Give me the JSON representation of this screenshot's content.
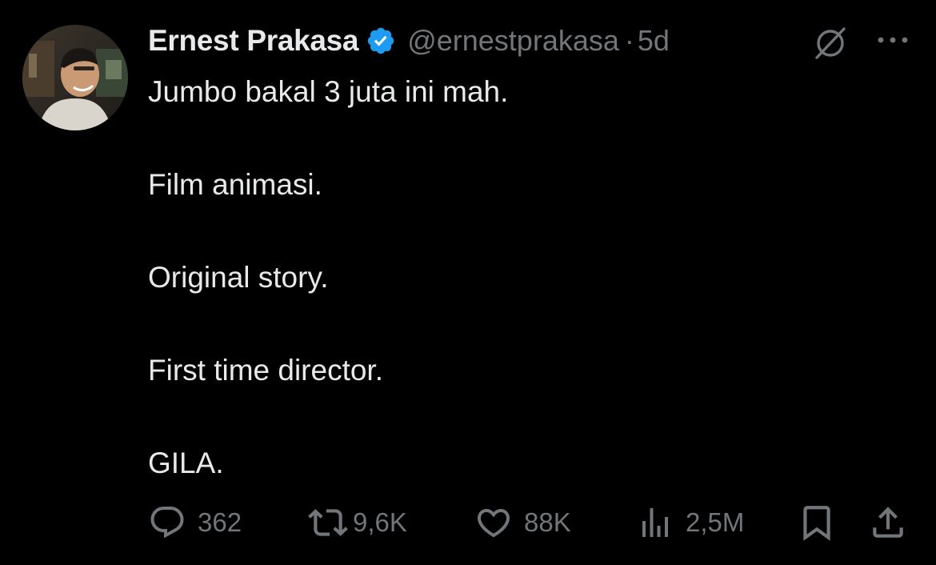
{
  "author": {
    "display_name": "Ernest Prakasa",
    "handle": "@ernestprakasa",
    "separator": "·",
    "time": "5d",
    "verified_color": "#1d9bf0"
  },
  "tweet": {
    "lines": [
      "Jumbo bakal 3 juta ini mah.",
      "Film animasi.",
      "Original story.",
      "First time director.",
      "GILA."
    ]
  },
  "actions": {
    "reply_count": "362",
    "retweet_count": "9,6K",
    "like_count": "88K",
    "view_count": "2,5M"
  },
  "icons": {
    "verified": "verified-badge-icon",
    "grok": "grok-icon",
    "more": "more-dots-icon",
    "reply": "reply-icon",
    "retweet": "retweet-icon",
    "like": "heart-icon",
    "views": "views-chart-icon",
    "bookmark": "bookmark-icon",
    "share": "share-icon"
  },
  "colors": {
    "background": "#000000",
    "text": "#e7e9ea",
    "secondary": "#71767b",
    "accent": "#1d9bf0"
  }
}
